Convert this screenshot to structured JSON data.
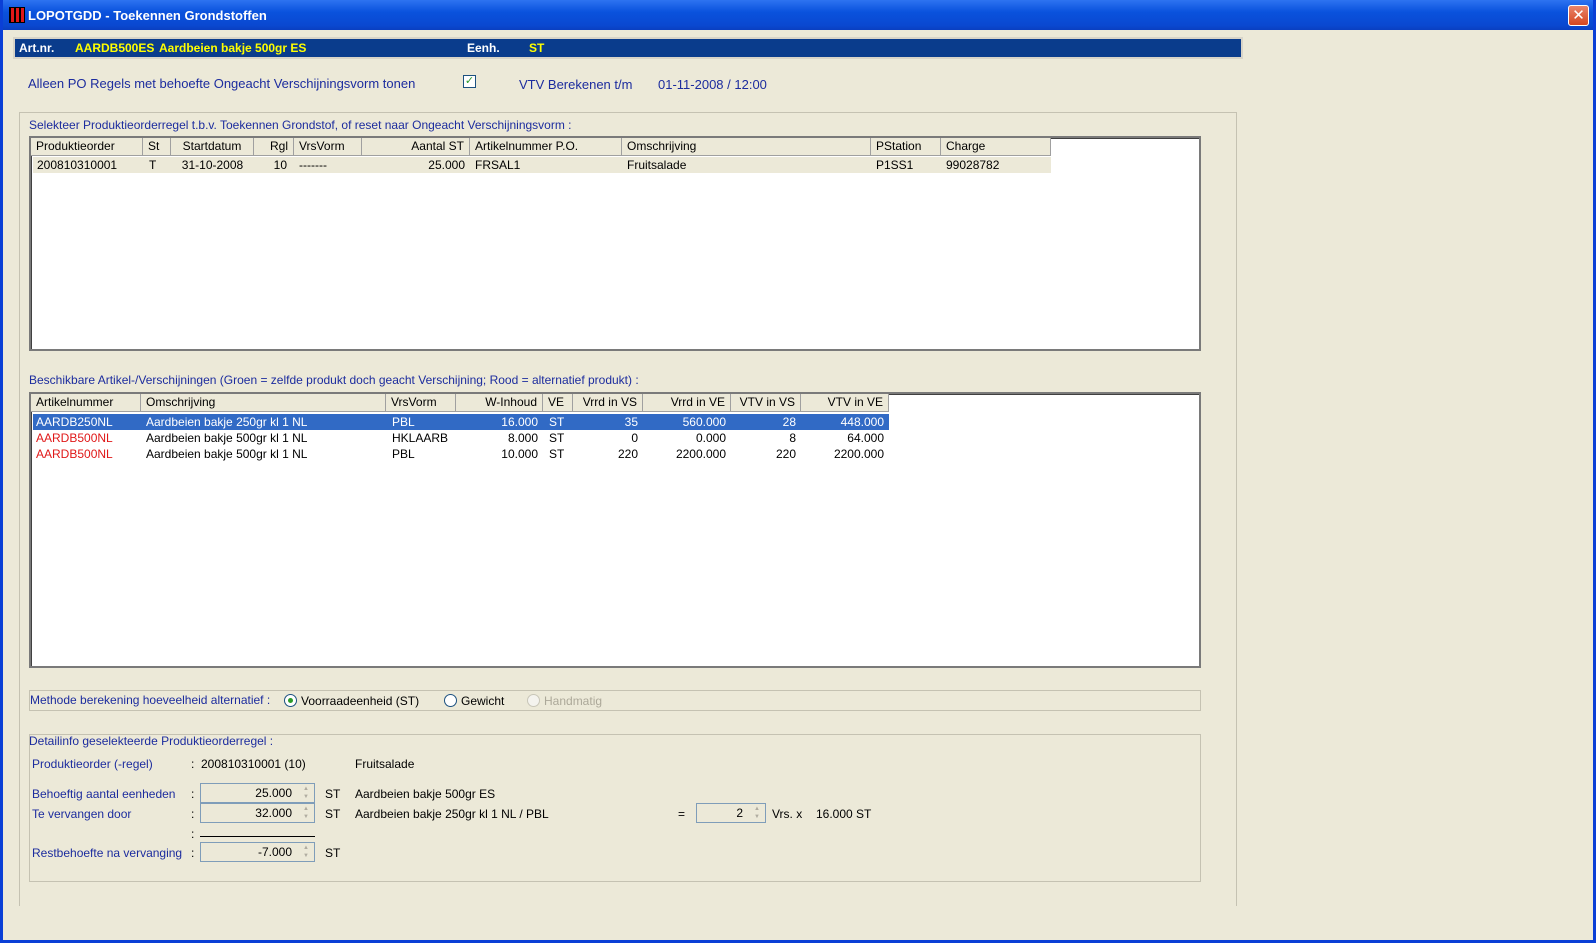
{
  "window": {
    "title": "LOPOTGDD - Toekennen Grondstoffen",
    "close_label": "✕"
  },
  "header": {
    "artnr_label": "Art.nr.",
    "artnr_value": "AARDB500ES",
    "art_desc": "Aardbeien bakje 500gr ES",
    "eenh_label": "Eenh.",
    "eenh_value": "ST"
  },
  "filter": {
    "checkbox_label": "Alleen PO Regels met behoefte Ongeacht Verschijningsvorm tonen",
    "checked_mark": "✓",
    "vtv_label": "VTV Berekenen t/m",
    "vtv_value": "01-11-2008 / 12:00"
  },
  "po_section": {
    "caption": "Selekteer Produktieorderregel t.b.v. Toekennen Grondstof, of reset naar Ongeacht Verschijningsvorm :",
    "columns": [
      "Produktieorder",
      "St",
      "Startdatum",
      "Rgl",
      "VrsVorm",
      "Aantal ST",
      "Artikelnummer P.O.",
      "Omschrijving",
      "PStation",
      "Charge"
    ],
    "rows": [
      [
        "200810310001",
        "T",
        "31-10-2008",
        "10",
        "-------",
        "25.000",
        "FRSAL1",
        "Fruitsalade",
        "P1SS1",
        "99028782"
      ]
    ]
  },
  "art_section": {
    "caption": "Beschikbare Artikel-/Verschijningen (Groen = zelfde produkt doch geacht Verschijning; Rood = alternatief produkt) :",
    "columns": [
      "Artikelnummer",
      "Omschrijving",
      "VrsVorm",
      "W-Inhoud",
      "VE",
      "Vrrd in VS",
      "Vrrd in VE",
      "VTV in VS",
      "VTV in VE"
    ],
    "rows": [
      [
        "AARDB250NL",
        "Aardbeien bakje 250gr kl 1 NL",
        "PBL",
        "16.000",
        "ST",
        "35",
        "560.000",
        "28",
        "448.000"
      ],
      [
        "AARDB500NL",
        "Aardbeien bakje 500gr kl 1 NL",
        "HKLAARB",
        "8.000",
        "ST",
        "0",
        "0.000",
        "8",
        "64.000"
      ],
      [
        "AARDB500NL",
        "Aardbeien bakje 500gr kl 1 NL",
        "PBL",
        "10.000",
        "ST",
        "220",
        "2200.000",
        "220",
        "2200.000"
      ]
    ]
  },
  "method": {
    "label": "Methode berekening hoeveelheid alternatief :",
    "opt1": "Voorraadeenheid (ST)",
    "opt2": "Gewicht",
    "opt3": "Handmatig"
  },
  "detail": {
    "caption": "Detailinfo geselekteerde Produktieorderregel :",
    "po_label": "Produktieorder (-regel)",
    "colon": ":",
    "po_value": "200810310001 (10)",
    "po_desc": "Fruitsalade",
    "need_label": "Behoeftig aantal eenheden",
    "need_value": "25.000",
    "need_unit": "ST",
    "need_desc": "Aardbeien bakje 500gr ES",
    "repl_label": "Te vervangen door",
    "repl_value": "32.000",
    "repl_unit": "ST",
    "repl_desc": "Aardbeien bakje 250gr kl 1 NL / PBL",
    "eq": "=",
    "vrs_value": "2",
    "vrs_label": "Vrs.  x",
    "vrs_qty": "16.000 ST",
    "rest_label": "Restbehoefte na vervanging",
    "rest_value": "-7.000",
    "rest_unit": "ST"
  }
}
